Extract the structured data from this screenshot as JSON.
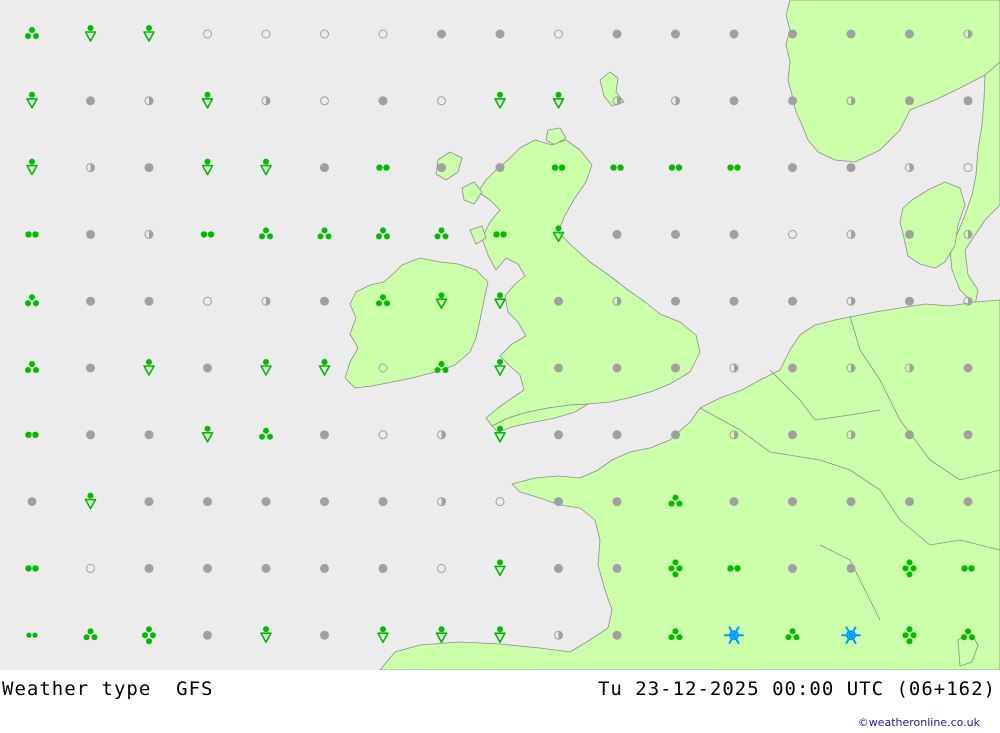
{
  "footer": {
    "product": "Weather type",
    "model": "GFS",
    "datetime": "Tu 23-12-2025 00:00 UTC (06+162)",
    "credit": "©weatheronline.co.uk"
  },
  "colors": {
    "sea": "#ececec",
    "land": "#ccffaa",
    "coast": "#8c8c8c",
    "no_precip": "#a0a0a0",
    "rain": "#00bb00",
    "snow": "#0099ff"
  },
  "legend_symbols": [
    "overcast-dot",
    "partly-cloudy-half",
    "clear-circle",
    "drizzle",
    "rain",
    "heavy-rain",
    "showers",
    "thundery-showers",
    "snow"
  ],
  "grid": [
    [
      "heavy-rain",
      "showers",
      "showers",
      "clear-circle",
      "clear-circle",
      "clear-circle",
      "clear-circle",
      "overcast-dot",
      "overcast-dot",
      "clear-circle",
      "overcast-dot",
      "overcast-dot",
      "overcast-dot",
      "overcast-dot",
      "overcast-dot",
      "overcast-dot",
      "partly-cloudy-half"
    ],
    [
      "showers",
      "overcast-dot",
      "partly-cloudy-half",
      "showers",
      "partly-cloudy-half",
      "clear-circle",
      "overcast-dot",
      "clear-circle",
      "showers",
      "showers",
      "partly-cloudy-half",
      "partly-cloudy-half",
      "overcast-dot",
      "overcast-dot",
      "partly-cloudy-half",
      "overcast-dot",
      "overcast-dot"
    ],
    [
      "showers",
      "partly-cloudy-half",
      "overcast-dot",
      "showers",
      "showers",
      "overcast-dot",
      "rain",
      "overcast-dot",
      "overcast-dot",
      "rain",
      "rain",
      "rain",
      "rain",
      "overcast-dot",
      "overcast-dot",
      "partly-cloudy-half",
      "clear-circle"
    ],
    [
      "rain",
      "overcast-dot",
      "partly-cloudy-half",
      "rain",
      "heavy-rain",
      "heavy-rain",
      "heavy-rain",
      "heavy-rain",
      "rain",
      "showers",
      "overcast-dot",
      "overcast-dot",
      "overcast-dot",
      "clear-circle",
      "partly-cloudy-half",
      "overcast-dot",
      "partly-cloudy-half"
    ],
    [
      "heavy-rain",
      "overcast-dot",
      "overcast-dot",
      "clear-circle",
      "partly-cloudy-half",
      "overcast-dot",
      "heavy-rain",
      "showers",
      "showers",
      "overcast-dot",
      "partly-cloudy-half",
      "overcast-dot",
      "overcast-dot",
      "overcast-dot",
      "partly-cloudy-half",
      "overcast-dot",
      "partly-cloudy-half"
    ],
    [
      "heavy-rain",
      "overcast-dot",
      "showers",
      "overcast-dot",
      "showers",
      "showers",
      "clear-circle",
      "heavy-rain",
      "showers",
      "overcast-dot",
      "overcast-dot",
      "overcast-dot",
      "partly-cloudy-half",
      "overcast-dot",
      "partly-cloudy-half",
      "partly-cloudy-half",
      "overcast-dot"
    ],
    [
      "rain",
      "overcast-dot",
      "overcast-dot",
      "showers",
      "heavy-rain",
      "overcast-dot",
      "clear-circle",
      "partly-cloudy-half",
      "showers",
      "overcast-dot",
      "overcast-dot",
      "overcast-dot",
      "partly-cloudy-half",
      "overcast-dot",
      "partly-cloudy-half",
      "overcast-dot",
      "overcast-dot"
    ],
    [
      "overcast-dot",
      "showers",
      "overcast-dot",
      "overcast-dot",
      "overcast-dot",
      "overcast-dot",
      "overcast-dot",
      "partly-cloudy-half",
      "clear-circle",
      "overcast-dot",
      "overcast-dot",
      "heavy-rain",
      "overcast-dot",
      "overcast-dot",
      "overcast-dot",
      "overcast-dot",
      "overcast-dot"
    ],
    [
      "rain",
      "clear-circle",
      "overcast-dot",
      "overcast-dot",
      "overcast-dot",
      "overcast-dot",
      "overcast-dot",
      "clear-circle",
      "showers",
      "overcast-dot",
      "overcast-dot",
      "thundery-showers",
      "rain",
      "overcast-dot",
      "overcast-dot",
      "thundery-showers",
      "rain"
    ],
    [
      "drizzle",
      "heavy-rain",
      "thundery-showers",
      "overcast-dot",
      "showers",
      "overcast-dot",
      "showers",
      "showers",
      "showers",
      "partly-cloudy-half",
      "overcast-dot",
      "heavy-rain",
      "snow",
      "heavy-rain",
      "snow",
      "thundery-showers",
      "heavy-rain"
    ]
  ]
}
